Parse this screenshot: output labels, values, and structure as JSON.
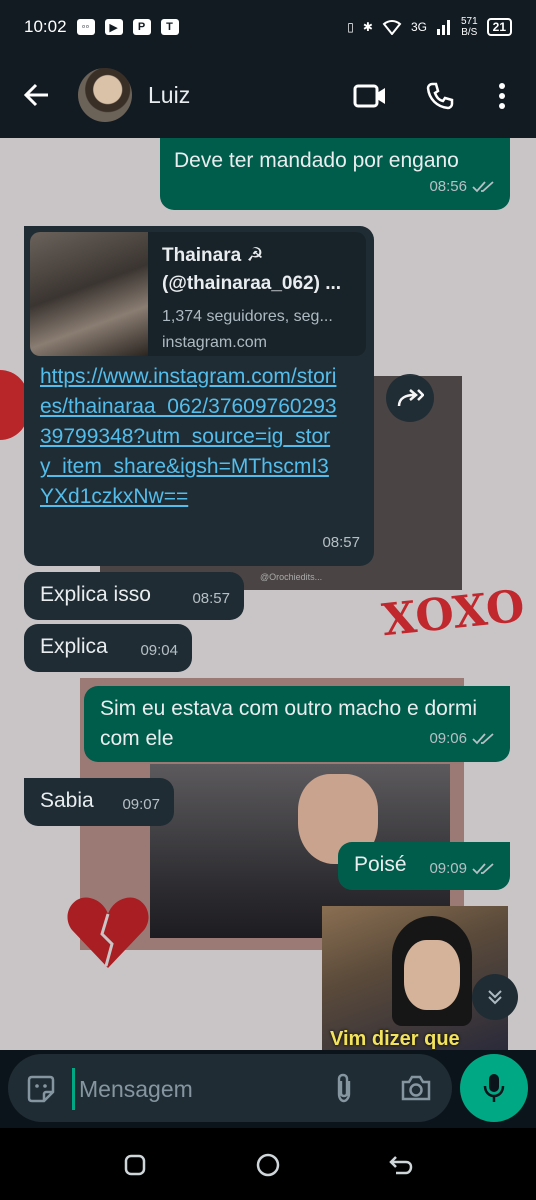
{
  "status_bar": {
    "time": "10:02",
    "network": "3G",
    "speed_value": "571",
    "speed_unit": "B/S",
    "battery": "21"
  },
  "header": {
    "contact_name": "Luiz"
  },
  "messages": [
    {
      "text": "Deve ter mandado por engano",
      "time": "08:56"
    },
    {
      "preview_title": "Thainara ☭ (@thainaraa_062) ...",
      "preview_sub": "1,374 seguidores, seg...",
      "preview_domain": "instagram.com",
      "link": "https://www.instagram.com/stories/thainaraa_062/3760976029339799348?utm_source=ig_story_item_share&igsh=MThscmI3YXd1czkxNw==",
      "time": "08:57"
    },
    {
      "text": "Explica isso",
      "time": "08:57"
    },
    {
      "text": "Explica",
      "time": "09:04"
    },
    {
      "text": "Sim eu estava com outro macho e dormi com ele",
      "time": "09:06"
    },
    {
      "text": "Sabia",
      "time": "09:07"
    },
    {
      "text": "Poisé",
      "time": "09:09"
    }
  ],
  "wallpaper": {
    "xoxo": "XOXO",
    "watermark": "@Orochiedits..."
  },
  "sticker_caption": "Vim dizer que",
  "input": {
    "placeholder": "Mensagem"
  },
  "colors": {
    "incoming": "#1f2c34",
    "outgoing": "#005c4b",
    "accent": "#00a884",
    "link": "#53bdeb"
  }
}
